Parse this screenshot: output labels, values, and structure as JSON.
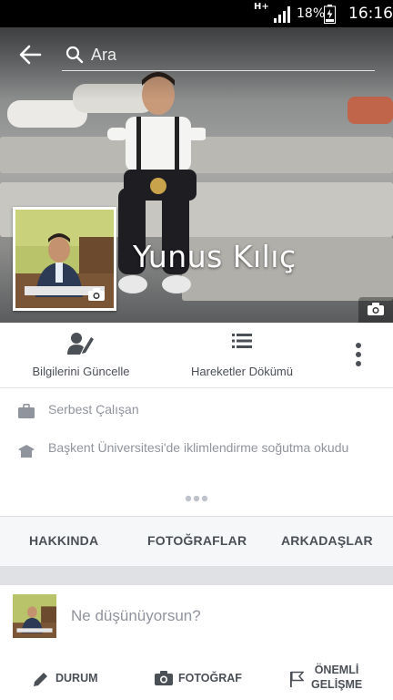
{
  "status_bar": {
    "network": "H+",
    "battery_percent": "18%",
    "time": "16:16"
  },
  "header": {
    "back_icon": "arrow-left-icon",
    "search_icon": "search-icon",
    "search_placeholder": "Ara"
  },
  "profile": {
    "name": "Yunus Kılıç"
  },
  "actions": [
    {
      "label": "Bilgilerini Güncelle",
      "icon": "edit-profile-icon"
    },
    {
      "label": "Hareketler Dökümü",
      "icon": "list-icon"
    },
    {
      "icon": "more-vertical-icon"
    }
  ],
  "info": {
    "work": "Serbest Çalışan",
    "education": "Başkent Üniversitesi'de iklimlendirme soğutma okudu"
  },
  "tabs": [
    "HAKKINDA",
    "FOTOĞRAFLAR",
    "ARKADAŞLAR"
  ],
  "composer": {
    "prompt": "Ne düşünüyorsun?",
    "status_label": "DURUM",
    "photo_label": "FOTOĞRAF",
    "event_label_line1": "ÖNEMLİ",
    "event_label_line2": "GELİŞME"
  },
  "colors": {
    "text_muted": "#90949c",
    "text_dark": "#4b4f56",
    "icon": "#4b4f56"
  }
}
